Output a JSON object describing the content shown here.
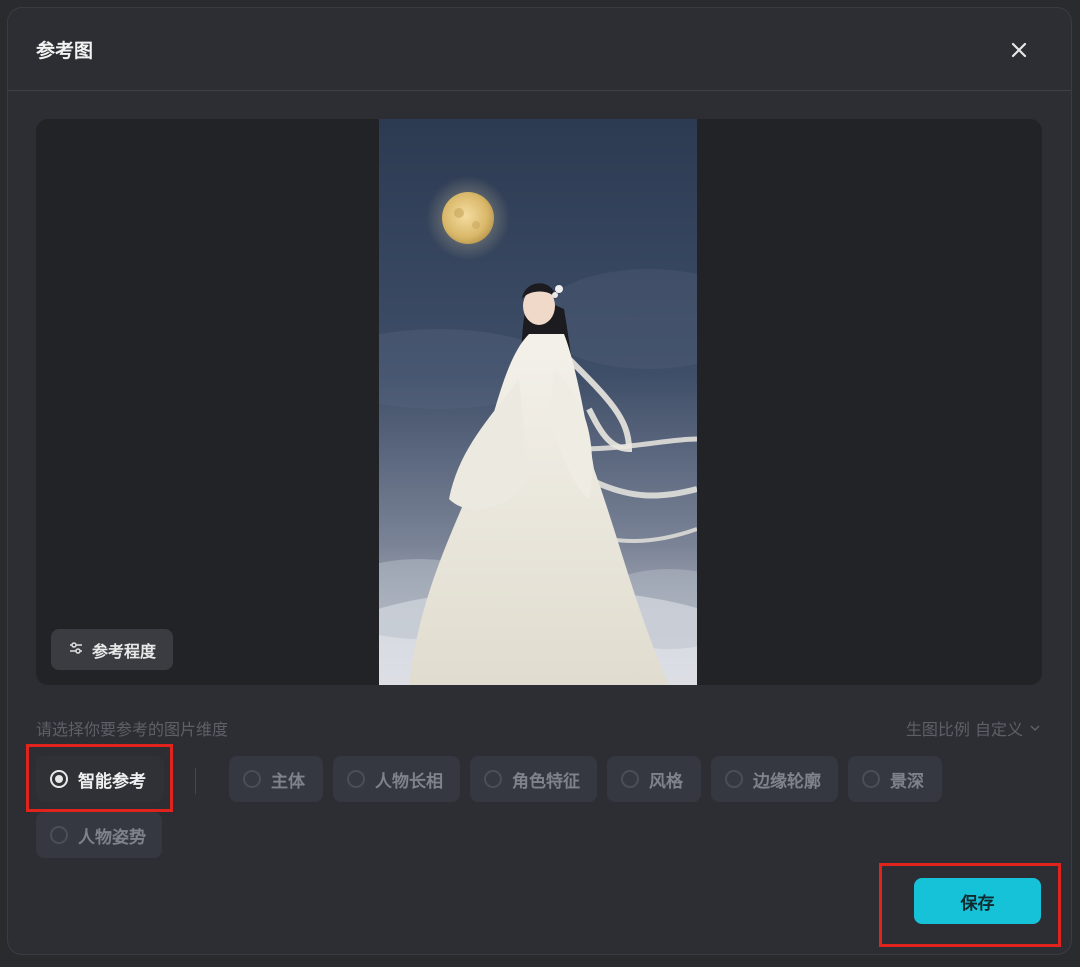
{
  "dialog": {
    "title": "参考图",
    "close_icon": "close-icon"
  },
  "preview": {
    "degree_button_label": "参考程度",
    "degree_icon": "sliders-icon"
  },
  "dimensions": {
    "hint": "请选择你要参考的图片维度",
    "ratio_label": "生图比例 自定义",
    "options": [
      {
        "label": "智能参考",
        "selected": true
      },
      {
        "label": "主体",
        "selected": false
      },
      {
        "label": "人物长相",
        "selected": false
      },
      {
        "label": "角色特征",
        "selected": false
      },
      {
        "label": "风格",
        "selected": false
      },
      {
        "label": "边缘轮廓",
        "selected": false
      },
      {
        "label": "景深",
        "selected": false
      },
      {
        "label": "人物姿势",
        "selected": false
      }
    ]
  },
  "footer": {
    "save_label": "保存"
  },
  "colors": {
    "accent": "#16c2d8",
    "highlight": "#e0231c"
  }
}
